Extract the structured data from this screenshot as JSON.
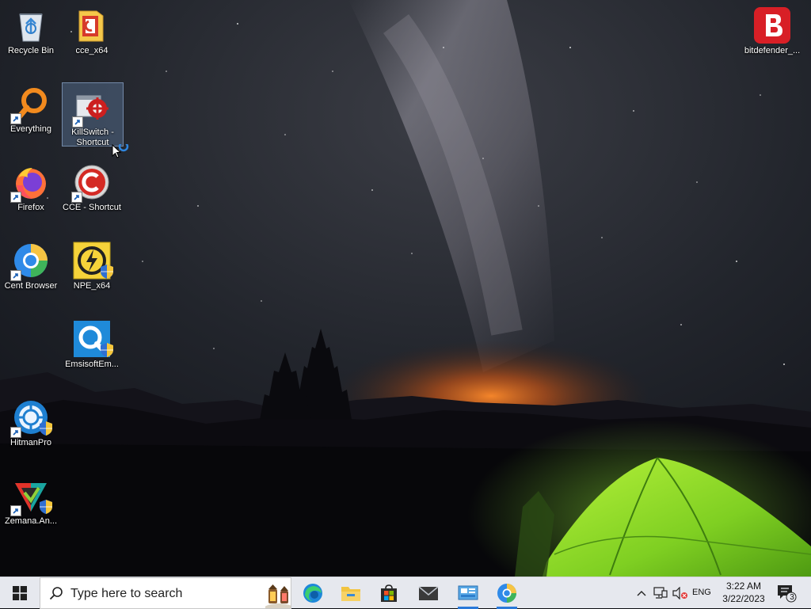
{
  "desktop": {
    "icons": [
      {
        "label": "Recycle Bin"
      },
      {
        "label": "cce_x64"
      },
      {
        "label": "Everything"
      },
      {
        "label": "KillSwitch - Shortcut"
      },
      {
        "label": "Firefox"
      },
      {
        "label": "CCE - Shortcut"
      },
      {
        "label": "Cent Browser"
      },
      {
        "label": "NPE_x64"
      },
      {
        "label": "EmsisoftEm..."
      },
      {
        "label": "HitmanPro"
      },
      {
        "label": "Zemana.An..."
      },
      {
        "label": "bitdefender_..."
      }
    ]
  },
  "taskbar": {
    "search_placeholder": "Type here to search",
    "pinned": [
      "edge-icon",
      "file-explorer-icon",
      "store-icon",
      "mail-icon",
      "control-panel-icon",
      "cent-browser-icon"
    ],
    "language": "ENG",
    "time": "3:22 AM",
    "date": "3/22/2023",
    "notification_count": "3"
  },
  "colors": {
    "taskbar_bg": "#e6e8ee",
    "accent": "#2b79d9",
    "bitdefender_red": "#d81f26"
  }
}
